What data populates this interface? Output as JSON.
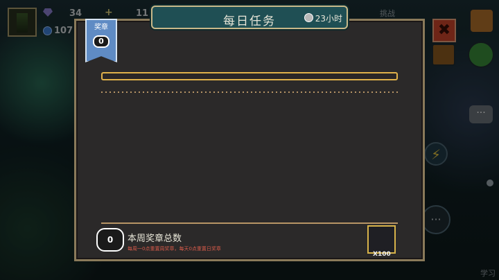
{
  "hud": {
    "gems": "34",
    "gold": "11",
    "coins": "107",
    "challenge_label": "挑战"
  },
  "dialog": {
    "title": "每日任务",
    "timer": "23小时",
    "medal_label": "奖章",
    "medal_count": "0",
    "progress": 0
  },
  "footer": {
    "medal_count": "0",
    "title": "本周奖章总数",
    "note": "每周一0点重置周奖章，每天0点重置日奖章",
    "reward_qty": "X100"
  },
  "side": {
    "close_symbol": "✖",
    "learn": "学习",
    "chat_bubble": "···"
  },
  "colors": {
    "accent_gold": "#e0b14a",
    "title_teal": "#1f4f54",
    "panel_bg": "#2b2929",
    "ribbon_blue": "#5f8bc4",
    "close_red": "#c8442b"
  }
}
